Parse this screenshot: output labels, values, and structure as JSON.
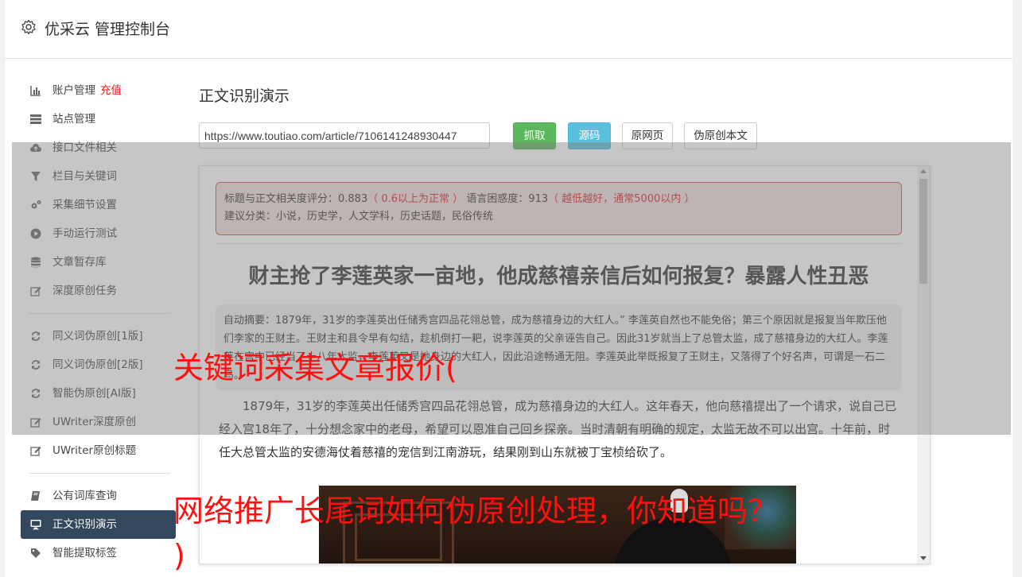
{
  "header": {
    "title": "优采云 管理控制台"
  },
  "sidebar": {
    "items": [
      {
        "label": "账户管理",
        "extra": "充值",
        "icon": "bar-chart-icon"
      },
      {
        "label": "站点管理",
        "icon": "server-icon"
      },
      {
        "label": "接口文件相关",
        "icon": "cloud-upload-icon"
      },
      {
        "label": "栏目与关键词",
        "icon": "filter-icon"
      },
      {
        "label": "采集细节设置",
        "icon": "gears-icon"
      },
      {
        "label": "手动运行测试",
        "icon": "play-circle-icon"
      },
      {
        "label": "文章暂存库",
        "icon": "database-icon"
      },
      {
        "label": "深度原创任务",
        "icon": "edit-icon"
      },
      {
        "label": "同义词伪原创[1版]",
        "icon": "refresh-icon"
      },
      {
        "label": "同义词伪原创[2版]",
        "icon": "refresh-icon"
      },
      {
        "label": "智能伪原创[AI版]",
        "icon": "refresh-icon"
      },
      {
        "label": "UWriter深度原创",
        "icon": "edit-icon"
      },
      {
        "label": "UWriter原创标题",
        "icon": "edit-icon"
      },
      {
        "label": "公有词库查询",
        "icon": "book-icon"
      },
      {
        "label": "正文识别演示",
        "icon": "desktop-icon"
      },
      {
        "label": "智能提取标签",
        "icon": "tag-icon"
      }
    ]
  },
  "main": {
    "page_title": "正文识别演示",
    "url_value": "https://www.toutiao.com/article/7106141248930447",
    "buttons": {
      "fetch": "抓取",
      "source": "源码",
      "original_page": "原网页",
      "rewrite": "伪原创本文"
    },
    "analysis": {
      "relevance_label": "标题与正文相关度评分：0.883",
      "relevance_note": "（ 0.6以上为正常 ）",
      "perplexity_label": "语言困惑度：913",
      "perplexity_note": "（ 越低越好，通常5000以内 ）",
      "category": "建议分类：小说，历史学，人文学科，历史话题，民俗传统"
    },
    "article": {
      "title": "财主抢了李莲英家一亩地，他成慈禧亲信后如何报复？暴露人性丑恶",
      "summary": "自动摘要：1879年，31岁的李莲英出任储秀宫四品花翎总管，成为慈禧身边的大红人。” 李莲英自然也不能免俗；第三个原因就是报复当年欺压他们李家的王财主。王财主和县令早有勾结，趁机倒打一耙，说李莲英的父亲诬告自己。因此31岁就当上了总管太监，成了慈禧身边的大红人。李莲英在宫中已经当了十八年太监，李莲英又是她身边的大红人，因此沿途畅通无阻。李莲英此举既报复了王财主，又落得了个好名声，可谓是一石二鸟。",
      "paragraph": "1879年，31岁的李莲英出任储秀宫四品花翎总管，成为慈禧身边的大红人。这年春天，他向慈禧提出了一个请求，说自己已经入宫18年了，十分想念家中的老母，希望可以恩准自己回乡探亲。当时清朝有明确的规定，太监无故不可以出宫。十年前，时任大总管太监的安德海仗着慈禧的宠信到江南游玩，结果刚到山东就被丁宝桢给砍了。"
    }
  },
  "watermarks": {
    "line1": "关键词采集文章报价(",
    "line2": "网络推广长尾词如何伪原创处理，你知道吗？",
    "line3": ")"
  }
}
